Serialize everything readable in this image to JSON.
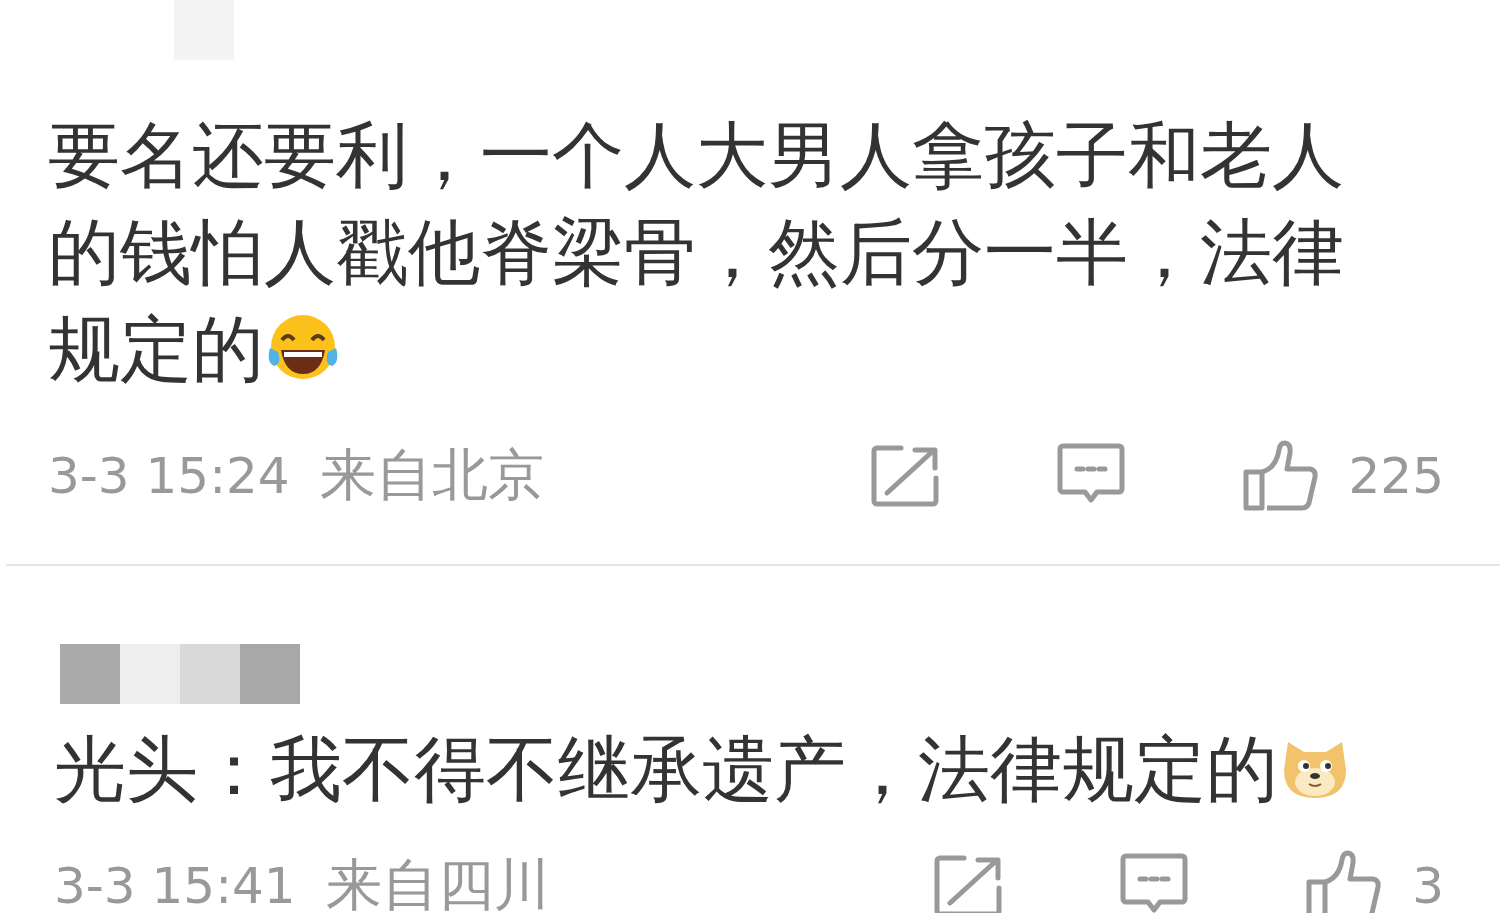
{
  "comments": [
    {
      "kind": "laugh",
      "text": "要名还要利，一个人大男人拿孩子和老人的钱怕人戳他脊梁骨，然后分一半，法律规定的",
      "time": "3-3 15:24",
      "location": "来自北京",
      "likes": "225"
    },
    {
      "kind": "dog",
      "text": "光头：我不得不继承遗产，法律规定的",
      "time": "3-3 15:41",
      "location": "来自四川",
      "likes": "3"
    }
  ]
}
